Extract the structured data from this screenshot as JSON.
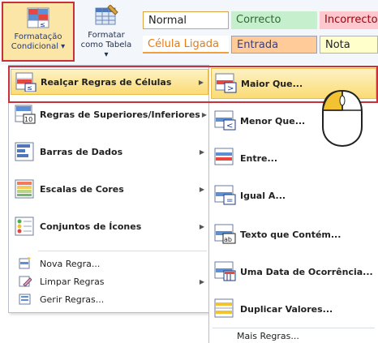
{
  "ribbon": {
    "cf_line1": "Formatação",
    "cf_line2": "Condicional",
    "ft_line1": "Formatar",
    "ft_line2": "como Tabela",
    "styles": {
      "normal": "Normal",
      "correcto": "Correcto",
      "incorrecto": "Incorrecto",
      "celula_ligada": "Célula Ligada",
      "entrada": "Entrada",
      "nota": "Nota"
    }
  },
  "menu": {
    "items": [
      {
        "label": "Realçar Regras de Células",
        "icon": "highlight-cells-icon"
      },
      {
        "label": "Regras de Superiores/Inferiores",
        "icon": "top-bottom-icon"
      },
      {
        "label": "Barras de Dados",
        "icon": "data-bars-icon"
      },
      {
        "label": "Escalas de Cores",
        "icon": "color-scales-icon"
      },
      {
        "label": "Conjuntos de Ícones",
        "icon": "icon-sets-icon"
      }
    ],
    "small_items": [
      {
        "label": "Nova Regra..."
      },
      {
        "label": "Limpar Regras"
      },
      {
        "label": "Gerir Regras..."
      }
    ]
  },
  "submenu": {
    "items": [
      {
        "label": "Maior Que..."
      },
      {
        "label": "Menor Que..."
      },
      {
        "label": "Entre..."
      },
      {
        "label": "Igual A..."
      },
      {
        "label": "Texto que Contém..."
      },
      {
        "label": "Uma Data de Ocorrência..."
      },
      {
        "label": "Duplicar Valores..."
      }
    ],
    "more": "Mais Regras..."
  },
  "colors": {
    "highlight": "#fbdb75",
    "red_box": "#c8313a",
    "good_bg": "#c6efce",
    "bad_bg": "#ffc7ce",
    "input_bg": "#ffcc99",
    "note_bg": "#ffffcc"
  }
}
